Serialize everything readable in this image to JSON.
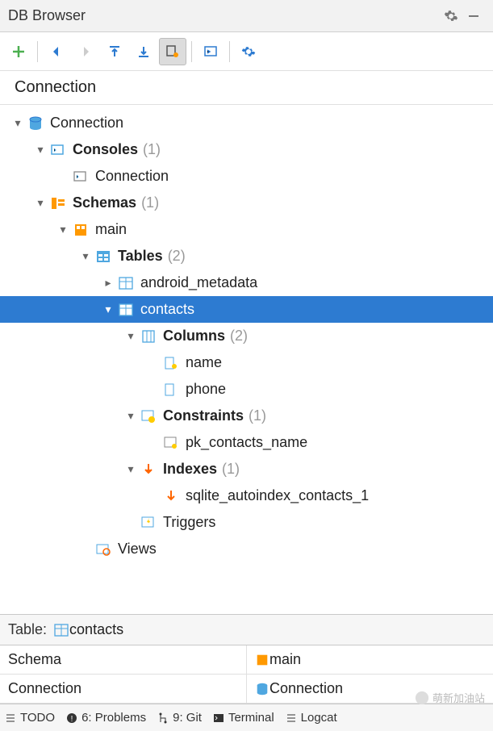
{
  "titlebar": {
    "title": "DB Browser"
  },
  "breadcrumb": {
    "path": "Connection"
  },
  "tree": {
    "root": {
      "label": "Connection"
    },
    "consoles": {
      "label": "Consoles",
      "count": "(1)",
      "child": "Connection"
    },
    "schemas": {
      "label": "Schemas",
      "count": "(1)"
    },
    "main_schema": {
      "label": "main"
    },
    "tables": {
      "label": "Tables",
      "count": "(2)"
    },
    "t1": {
      "label": "android_metadata"
    },
    "t2": {
      "label": "contacts"
    },
    "columns": {
      "label": "Columns",
      "count": "(2)",
      "c1": "name",
      "c2": "phone"
    },
    "constraints": {
      "label": "Constraints",
      "count": "(1)",
      "c1": "pk_contacts_name"
    },
    "indexes": {
      "label": "Indexes",
      "count": "(1)",
      "c1": "sqlite_autoindex_contacts_1"
    },
    "triggers": {
      "label": "Triggers"
    },
    "views": {
      "label": "Views"
    }
  },
  "details": {
    "table_key": "Table:",
    "table_val": "contacts",
    "rows": [
      {
        "k": "Schema",
        "v": "main",
        "icon": "schema"
      },
      {
        "k": "Connection",
        "v": "Connection",
        "icon": "db"
      }
    ]
  },
  "status": {
    "todo": "TODO",
    "problems": "6: Problems",
    "git": "9: Git",
    "terminal": "Terminal",
    "logcat": "Logcat"
  },
  "watermark": "萌新加油站"
}
